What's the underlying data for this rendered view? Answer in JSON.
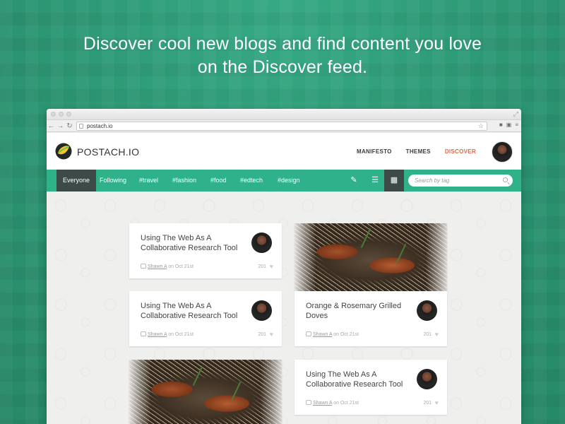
{
  "headline": {
    "line1": "Discover cool new blogs and find content you love",
    "line2": "on the Discover feed."
  },
  "browser": {
    "url": "postach.io"
  },
  "site": {
    "logo_text": "POSTACH.IO",
    "nav": [
      "MANIFESTO",
      "THEMES",
      "DISCOVER"
    ],
    "active_nav": "DISCOVER"
  },
  "tagbar": {
    "tabs": [
      "Everyone",
      "Following",
      "#travel",
      "#fashion",
      "#food",
      "#edtech",
      "#design"
    ],
    "active_tab": "Everyone",
    "search_placeholder": "Search by tag"
  },
  "cards": [
    {
      "title": "Using The Web As A Collaborative Research Tool",
      "author": "Shawn A",
      "date_text": "on Oct 21st",
      "likes": "201"
    },
    {
      "title": "Using The Web As A Collaborative Research Tool",
      "author": "Shawn A",
      "date_text": "on Oct 21st",
      "likes": "201"
    },
    {
      "title": "Orange & Rosemary Grilled Doves",
      "author": "Shawn A",
      "date_text": "on Oct 21st",
      "likes": "201"
    },
    {
      "title": "Using The Web As A Collaborative Research Tool",
      "author": "Shawn A",
      "date_text": "on Oct 21st",
      "likes": "201"
    }
  ],
  "colors": {
    "background": "#2f9e79",
    "tagbar": "#2fb189",
    "active_tab": "#3c4b47",
    "discover_accent": "#e0664a"
  }
}
